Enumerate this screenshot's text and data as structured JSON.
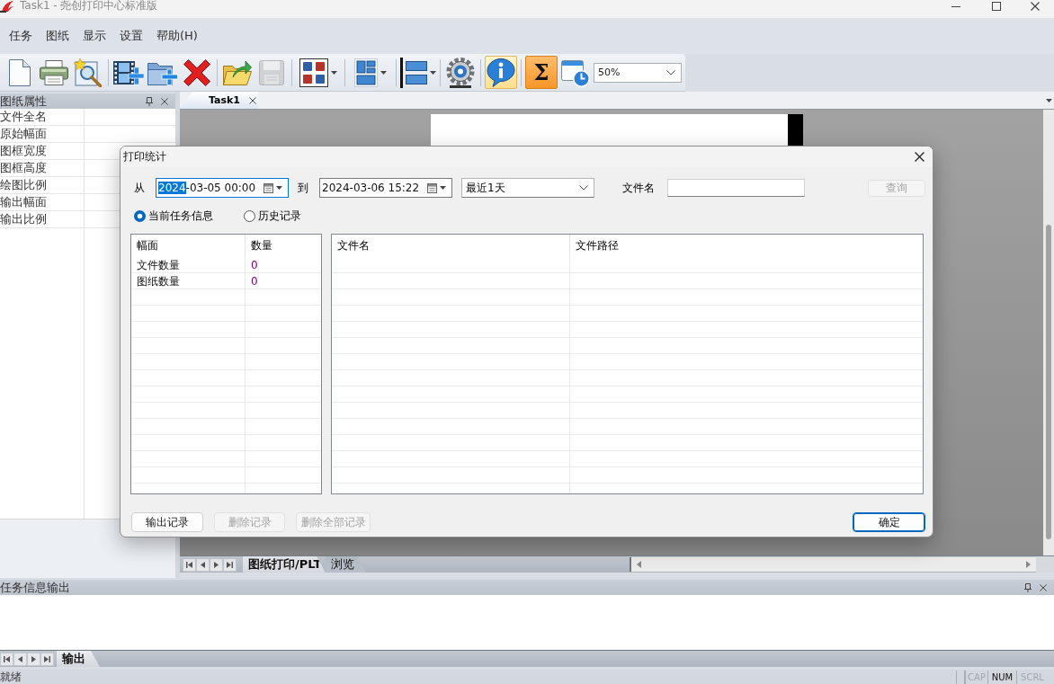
{
  "window": {
    "title": "Task1 - 尧创打印中心标准版"
  },
  "menu": [
    {
      "label": "任务"
    },
    {
      "label": "图纸"
    },
    {
      "label": "显示"
    },
    {
      "label": "设置"
    },
    {
      "label": "帮助(H)"
    }
  ],
  "toolbar": {
    "groups": [
      [
        {
          "kind": "new",
          "dropdown": false,
          "disabled": false,
          "hovered": false,
          "pressed": false
        },
        {
          "kind": "print",
          "dropdown": false,
          "disabled": false,
          "hovered": false,
          "pressed": false
        },
        {
          "kind": "preview",
          "dropdown": false,
          "disabled": false,
          "hovered": false,
          "pressed": false
        }
      ],
      [
        {
          "kind": "add-frames",
          "dropdown": false,
          "disabled": false,
          "hovered": false,
          "pressed": false
        },
        {
          "kind": "add-folder",
          "dropdown": false,
          "disabled": false,
          "hovered": false,
          "pressed": false
        },
        {
          "kind": "delete",
          "dropdown": false,
          "disabled": false,
          "hovered": false,
          "pressed": false
        }
      ],
      [
        {
          "kind": "open",
          "dropdown": false,
          "disabled": false,
          "hovered": false,
          "pressed": false
        },
        {
          "kind": "save",
          "dropdown": false,
          "disabled": true,
          "hovered": false,
          "pressed": false
        }
      ],
      [
        {
          "kind": "sort",
          "dropdown": true,
          "disabled": false,
          "hovered": false,
          "pressed": false
        }
      ],
      [
        {
          "kind": "layout",
          "dropdown": true,
          "disabled": false,
          "hovered": false,
          "pressed": false
        }
      ],
      [
        {
          "kind": "align",
          "dropdown": true,
          "disabled": false,
          "hovered": false,
          "pressed": false
        }
      ],
      [
        {
          "kind": "settings",
          "dropdown": false,
          "disabled": false,
          "hovered": false,
          "pressed": false
        }
      ],
      [
        {
          "kind": "info",
          "dropdown": false,
          "disabled": false,
          "hovered": true,
          "pressed": false
        }
      ],
      [
        {
          "kind": "sum",
          "label": "Σ",
          "dropdown": false,
          "disabled": false,
          "hovered": false,
          "pressed": true
        },
        {
          "kind": "schedule",
          "dropdown": false,
          "disabled": false,
          "hovered": false,
          "pressed": false
        }
      ]
    ],
    "zoom": {
      "value": "50%"
    }
  },
  "properties_panel": {
    "title": "图纸属性",
    "rows": [
      "文件全名",
      "原始幅面",
      "图框宽度",
      "图框高度",
      "绘图比例",
      "输出幅面",
      "输出比例"
    ]
  },
  "document_tabs": [
    {
      "label": "Task1",
      "selected": true
    }
  ],
  "dialog": {
    "title": "打印统计",
    "from": {
      "label": "从",
      "value": "2024-03-05 00:00",
      "focused": true
    },
    "to": {
      "label": "到",
      "value": "2024-03-06 15:22",
      "focused": false
    },
    "range": {
      "value": "最近1天"
    },
    "file_name": {
      "label": "文件名"
    },
    "query_button": {
      "label": "查询",
      "disabled": true
    },
    "views": [
      {
        "label": "当前任务信息",
        "selected": true
      },
      {
        "label": "历史记录",
        "selected": false
      }
    ],
    "summary_table": {
      "columns": [
        "幅面",
        "数量"
      ],
      "rows": [
        [
          "文件数量",
          "0"
        ],
        [
          "图纸数量",
          "0"
        ]
      ]
    },
    "files_table": {
      "columns": [
        "文件名",
        "文件路径"
      ]
    },
    "actions": [
      {
        "label": "输出记录",
        "disabled": false
      },
      {
        "label": "删除记录",
        "disabled": true
      },
      {
        "label": "删除全部记录",
        "disabled": true
      }
    ],
    "confirm_button": {
      "label": "确定",
      "disabled": false,
      "default": true
    }
  },
  "sheet_tabs": [
    {
      "label": "图纸打印/PLT",
      "selected": true
    },
    {
      "label": "浏览",
      "selected": false
    }
  ],
  "output_panel": {
    "title": "任务信息输出",
    "tabs": [
      {
        "label": "输出",
        "selected": true
      }
    ]
  },
  "status_bar": {
    "text": "就绪",
    "indicators": [
      {
        "label": "CAP",
        "on": false
      },
      {
        "label": "NUM",
        "on": true
      },
      {
        "label": "SCRL",
        "on": false
      }
    ]
  }
}
